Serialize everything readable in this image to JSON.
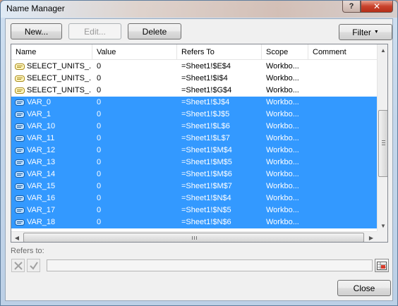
{
  "window": {
    "title": "Name Manager"
  },
  "titlebar": {
    "help_label": "?",
    "close_label": "✕"
  },
  "toolbar": {
    "new_label": "New...",
    "edit_label": "Edit...",
    "delete_label": "Delete",
    "filter_label": "Filter"
  },
  "table": {
    "columns": [
      "Name",
      "Value",
      "Refers To",
      "Scope",
      "Comment"
    ],
    "rows": [
      {
        "name": "SELECT_UNITS_...",
        "value": "0",
        "refers_to": "=Sheet1!$E$4",
        "scope": "Workbo...",
        "comment": "",
        "selected": false,
        "icon": "named-range-icon"
      },
      {
        "name": "SELECT_UNITS_...",
        "value": "0",
        "refers_to": "=Sheet1!$I$4",
        "scope": "Workbo...",
        "comment": "",
        "selected": false,
        "icon": "named-range-icon"
      },
      {
        "name": "SELECT_UNITS_...",
        "value": "0",
        "refers_to": "=Sheet1!$G$4",
        "scope": "Workbo...",
        "comment": "",
        "selected": false,
        "icon": "named-range-icon"
      },
      {
        "name": "VAR_0",
        "value": "0",
        "refers_to": "=Sheet1!$J$4",
        "scope": "Workbo...",
        "comment": "",
        "selected": true,
        "icon": "named-range-icon"
      },
      {
        "name": "VAR_1",
        "value": "0",
        "refers_to": "=Sheet1!$J$5",
        "scope": "Workbo...",
        "comment": "",
        "selected": true,
        "icon": "named-range-icon"
      },
      {
        "name": "VAR_10",
        "value": "0",
        "refers_to": "=Sheet1!$L$6",
        "scope": "Workbo...",
        "comment": "",
        "selected": true,
        "icon": "named-range-icon"
      },
      {
        "name": "VAR_11",
        "value": "0",
        "refers_to": "=Sheet1!$L$7",
        "scope": "Workbo...",
        "comment": "",
        "selected": true,
        "icon": "named-range-icon"
      },
      {
        "name": "VAR_12",
        "value": "0",
        "refers_to": "=Sheet1!$M$4",
        "scope": "Workbo...",
        "comment": "",
        "selected": true,
        "icon": "named-range-icon"
      },
      {
        "name": "VAR_13",
        "value": "0",
        "refers_to": "=Sheet1!$M$5",
        "scope": "Workbo...",
        "comment": "",
        "selected": true,
        "icon": "named-range-icon"
      },
      {
        "name": "VAR_14",
        "value": "0",
        "refers_to": "=Sheet1!$M$6",
        "scope": "Workbo...",
        "comment": "",
        "selected": true,
        "icon": "named-range-icon"
      },
      {
        "name": "VAR_15",
        "value": "0",
        "refers_to": "=Sheet1!$M$7",
        "scope": "Workbo...",
        "comment": "",
        "selected": true,
        "icon": "named-range-icon"
      },
      {
        "name": "VAR_16",
        "value": "0",
        "refers_to": "=Sheet1!$N$4",
        "scope": "Workbo...",
        "comment": "",
        "selected": true,
        "icon": "named-range-icon"
      },
      {
        "name": "VAR_17",
        "value": "0",
        "refers_to": "=Sheet1!$N$5",
        "scope": "Workbo...",
        "comment": "",
        "selected": true,
        "icon": "named-range-icon"
      },
      {
        "name": "VAR_18",
        "value": "0",
        "refers_to": "=Sheet1!$N$6",
        "scope": "Workbo...",
        "comment": "",
        "selected": true,
        "icon": "named-range-icon"
      }
    ]
  },
  "refers_to": {
    "label": "Refers to:",
    "value": ""
  },
  "footer": {
    "close_label": "Close"
  },
  "colors": {
    "selection": "#3399ff",
    "window_frame": "#c4d6ea"
  }
}
